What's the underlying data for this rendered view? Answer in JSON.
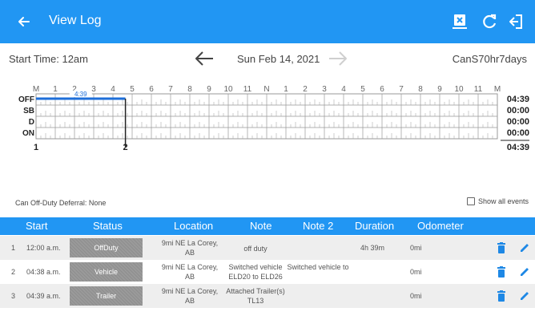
{
  "appbar": {
    "title": "View Log"
  },
  "subbar": {
    "start_time": "Start Time: 12am",
    "date": "Sun Feb 14, 2021",
    "ruleset": "CanS70hr7days"
  },
  "graph": {
    "hour_labels": [
      "M",
      "1",
      "2",
      "3",
      "4",
      "5",
      "6",
      "7",
      "8",
      "9",
      "10",
      "11",
      "N",
      "1",
      "2",
      "3",
      "4",
      "5",
      "6",
      "7",
      "8",
      "9",
      "10",
      "11",
      "M"
    ],
    "status_labels": [
      "OFF",
      "SB",
      "D",
      "ON"
    ],
    "totals": [
      "04:39",
      "00:00",
      "00:00",
      "00:00"
    ],
    "grand_total": "04:39",
    "bubble": "4:39",
    "marker_left": "1",
    "marker_right": "2",
    "off_duty_hours": 4.65
  },
  "deferral": "Can Off-Duty Deferral: None",
  "show_all": "Show all events",
  "table": {
    "headers": [
      "Start",
      "Status",
      "Location",
      "Note",
      "Note 2",
      "Duration",
      "Odometer"
    ],
    "rows": [
      {
        "num": "1",
        "start": "12:00 a.m.",
        "status": "OffDuty",
        "location": "9mi NE La Corey, AB",
        "note": "off duty",
        "note2": "",
        "duration": "4h 39m",
        "odometer": "0mi"
      },
      {
        "num": "2",
        "start": "04:38 a.m.",
        "status": "Vehicle",
        "location": "9mi NE La Corey, AB",
        "note": "Switched vehicle ELD20 to ELD26",
        "note2": "Switched vehicle to",
        "duration": "",
        "odometer": "0mi"
      },
      {
        "num": "3",
        "start": "04:39 a.m.",
        "status": "Trailer",
        "location": "9mi NE La Corey, AB",
        "note": "Attached Trailer(s) TL13",
        "note2": "",
        "duration": "",
        "odometer": "0mi"
      }
    ]
  },
  "colors": {
    "accent": "#2196f3",
    "status_fill": "#9a9a9a",
    "trash": "#1e88e5"
  }
}
